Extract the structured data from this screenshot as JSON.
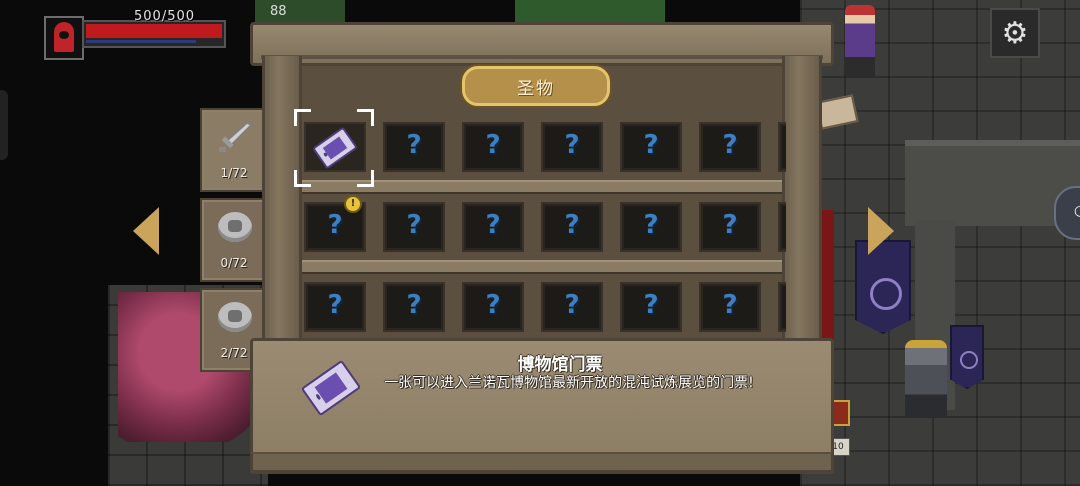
{
  "hud": {
    "health_text": "500/500",
    "health_fraction": 1.0,
    "top_counter": "88",
    "settings_icon": "gear-icon"
  },
  "panel": {
    "title": "圣物"
  },
  "categories": [
    {
      "name": "weapon",
      "icon": "sword-icon",
      "count": "1/72"
    },
    {
      "name": "armor",
      "icon": "shield-icon",
      "count": "0/72"
    },
    {
      "name": "accessory",
      "icon": "pouch-icon",
      "count": "2/72"
    }
  ],
  "grid": {
    "rows": [
      [
        "ticket",
        "?",
        "?",
        "?",
        "?",
        "?",
        "?"
      ],
      [
        "?",
        "?",
        "?",
        "?",
        "?",
        "?",
        "?"
      ],
      [
        "?",
        "?",
        "?",
        "?",
        "?",
        "?",
        "?"
      ]
    ],
    "selected_index": 0,
    "new_badge": "!"
  },
  "selected_item": {
    "name": "博物馆门票",
    "description": "一张可以进入兰诺瓦博物馆最新开放的混沌试炼展览的门票!",
    "icon": "museum-ticket-icon"
  },
  "world": {
    "shop_tag": "10"
  },
  "colors": {
    "accent_gold": "#c9a45a",
    "hp_red": "#c01a1f",
    "unknown_blue": "#3f7fc0",
    "wood": "#8b7c66"
  }
}
